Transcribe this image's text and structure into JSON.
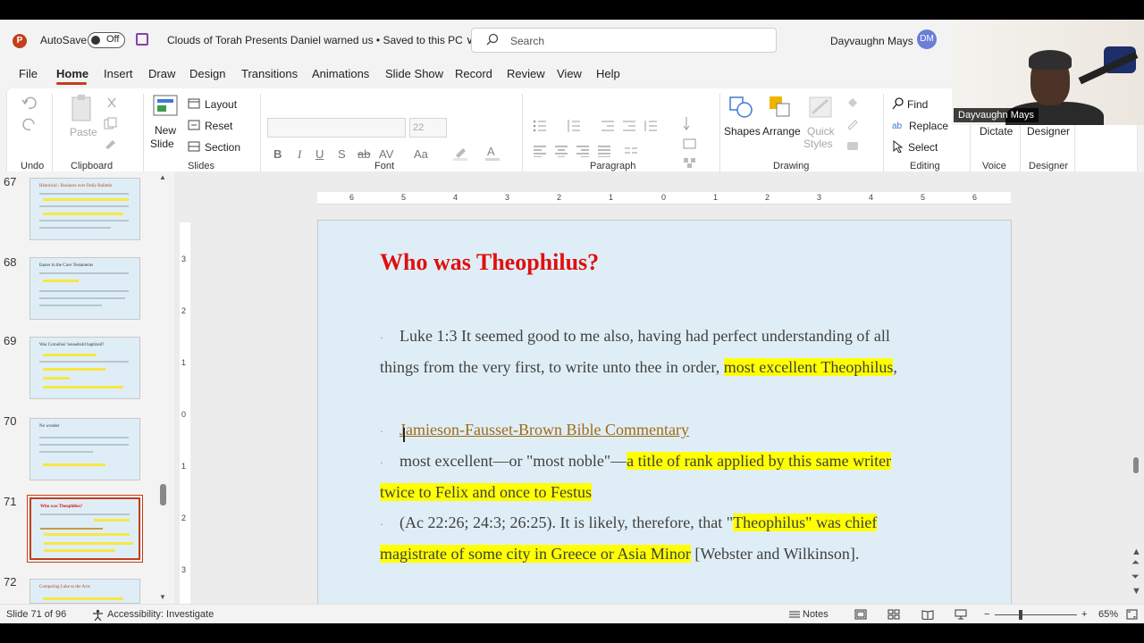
{
  "titlebar": {
    "autosave_label": "AutoSave",
    "autosave_state": "Off",
    "document_title": "Clouds of Torah Presents Daniel warned us • Saved to this PC ∨",
    "search_placeholder": "Search",
    "user_name": "Dayvaughn Mays",
    "user_initials": "DM"
  },
  "webcam": {
    "label": "Dayvaughn Mays"
  },
  "menu": [
    "File",
    "Home",
    "Insert",
    "Draw",
    "Design",
    "Transitions",
    "Animations",
    "Slide Show",
    "Record",
    "Review",
    "View",
    "Help"
  ],
  "ribbon": {
    "groups": {
      "undo": "Undo",
      "clipboard": "Clipboard",
      "slides": "Slides",
      "font": "Font",
      "paragraph": "Paragraph",
      "drawing": "Drawing",
      "editing": "Editing",
      "voice": "Voice",
      "designer": "Designer"
    },
    "paste": "Paste",
    "new_slide_1": "New",
    "new_slide_2": "Slide",
    "layout": "Layout",
    "reset": "Reset",
    "section": "Section",
    "font_size": "22",
    "shapes": "Shapes",
    "arrange": "Arrange",
    "quick_styles_1": "Quick",
    "quick_styles_2": "Styles",
    "find": "Find",
    "replace": "Replace",
    "select": "Select",
    "dictate": "Dictate",
    "designer_btn": "Designer"
  },
  "thumbnails": [
    {
      "num": "67",
      "title": "Historical / Business over Daily Bulletin"
    },
    {
      "num": "68",
      "title": "Easter in the Cave Testaments"
    },
    {
      "num": "69",
      "title": "Was Cornelius' household baptized?"
    },
    {
      "num": "70",
      "title": "No wonder"
    },
    {
      "num": "71",
      "title": "Who was Theophilus?"
    },
    {
      "num": "72",
      "title": "Comparing Luke to the Acts"
    }
  ],
  "slide": {
    "title": "Who was Theophilus?",
    "bullet": "·",
    "p1_a": "Luke 1:3 It seemed good to me also, having had perfect understanding of all",
    "p1_b": "things from the very first, to write unto thee in order, ",
    "p1_hl": "most excellent Theophilus",
    "p1_c": ",",
    "p2_link": "Jamieson-Fausset-Brown Bible Commentary",
    "p3_a": "most excellent—or \"most noble\"—",
    "p3_hl": "a title of rank applied by this same writer",
    "p3_hl2": "twice to Felix and once to Festus",
    "p4_a": "(Ac 22:26; 24:3; 26:25). It is likely, therefore, that \"",
    "p4_hl": "Theophilus\" was chief",
    "p4_hl2": "magistrate of some city in Greece or Asia Minor",
    "p4_b": " [Webster and Wilkinson]."
  },
  "ruler_h": [
    "6",
    "5",
    "4",
    "3",
    "2",
    "1",
    "0",
    "1",
    "2",
    "3",
    "4",
    "5",
    "6"
  ],
  "ruler_v": [
    "3",
    "2",
    "1",
    "0",
    "1",
    "2",
    "3"
  ],
  "status": {
    "slide_info": "Slide 71 of 96",
    "accessibility": "Accessibility: Investigate",
    "notes": "Notes",
    "zoom": "65%"
  }
}
